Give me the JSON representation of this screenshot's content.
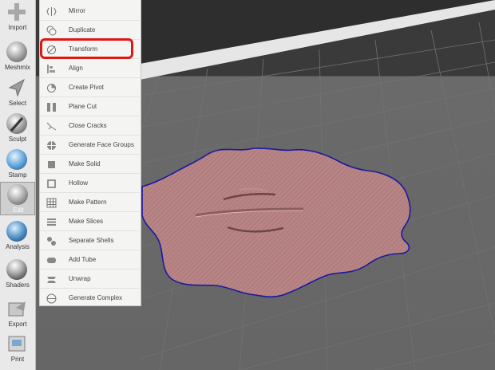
{
  "toolbar": {
    "items": [
      {
        "label": "Import",
        "icon": "import-icon"
      },
      {
        "label": "Meshmix",
        "icon": "meshmix-icon"
      },
      {
        "label": "Select",
        "icon": "select-icon"
      },
      {
        "label": "Sculpt",
        "icon": "sculpt-icon"
      },
      {
        "label": "Stamp",
        "icon": "stamp-icon"
      },
      {
        "label": "Edit",
        "icon": "edit-icon",
        "active": true
      },
      {
        "label": "Analysis",
        "icon": "analysis-icon"
      },
      {
        "label": "Shaders",
        "icon": "shaders-icon"
      },
      {
        "label": "Export",
        "icon": "export-icon"
      },
      {
        "label": "Print",
        "icon": "print-icon"
      }
    ]
  },
  "edit_menu": {
    "items": [
      {
        "label": "Mirror",
        "icon": "mirror-icon"
      },
      {
        "label": "Duplicate",
        "icon": "duplicate-icon"
      },
      {
        "label": "Transform",
        "icon": "transform-icon",
        "highlighted": true
      },
      {
        "label": "Align",
        "icon": "align-icon"
      },
      {
        "label": "Create Pivot",
        "icon": "pivot-icon"
      },
      {
        "label": "Plane Cut",
        "icon": "plane-cut-icon"
      },
      {
        "label": "Close Cracks",
        "icon": "close-cracks-icon"
      },
      {
        "label": "Generate Face Groups",
        "icon": "face-groups-icon"
      },
      {
        "label": "Make Solid",
        "icon": "make-solid-icon"
      },
      {
        "label": "Hollow",
        "icon": "hollow-icon"
      },
      {
        "label": "Make Pattern",
        "icon": "make-pattern-icon"
      },
      {
        "label": "Make Slices",
        "icon": "make-slices-icon"
      },
      {
        "label": "Separate Shells",
        "icon": "separate-shells-icon"
      },
      {
        "label": "Add Tube",
        "icon": "add-tube-icon"
      },
      {
        "label": "Unwrap",
        "icon": "unwrap-icon"
      },
      {
        "label": "Generate Complex",
        "icon": "generate-complex-icon"
      }
    ]
  },
  "colors": {
    "highlight": "#e01515",
    "mesh_fill": "#b88586",
    "mesh_outline": "#1a1aa0",
    "viewport_floor": "#666666",
    "panel": "#f4f4f2"
  }
}
